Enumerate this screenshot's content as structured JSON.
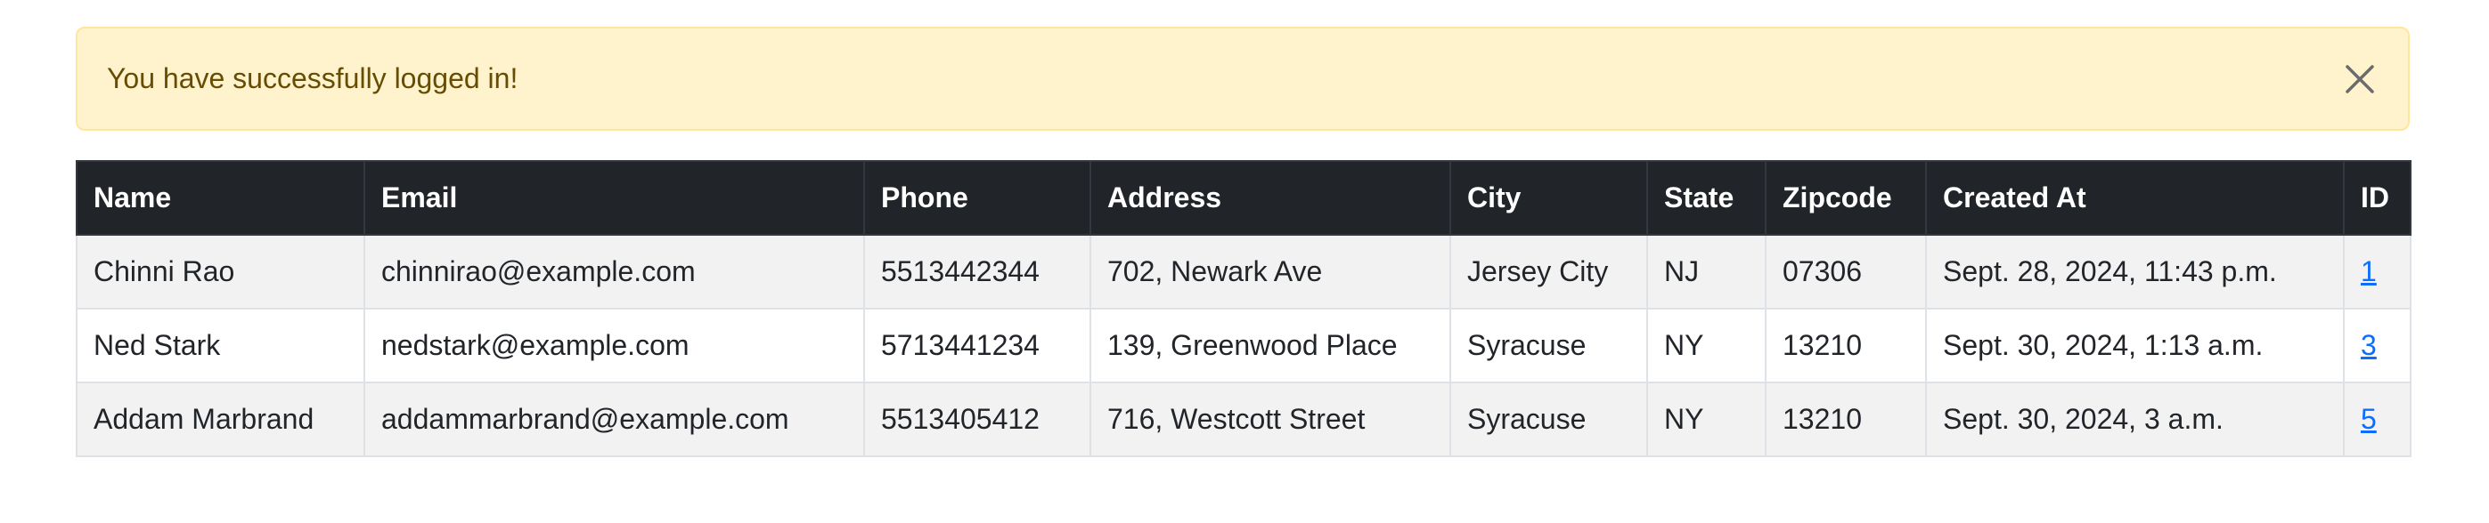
{
  "alert": {
    "message": "You have successfully logged in!",
    "close_icon": "close-icon"
  },
  "table": {
    "headers": [
      "Name",
      "Email",
      "Phone",
      "Address",
      "City",
      "State",
      "Zipcode",
      "Created At",
      "ID"
    ],
    "rows": [
      {
        "name": "Chinni Rao",
        "email": "chinnirao@example.com",
        "phone": "5513442344",
        "address": "702, Newark Ave",
        "city": "Jersey City",
        "state": "NJ",
        "zipcode": "07306",
        "created_at": "Sept. 28, 2024, 11:43 p.m.",
        "id": "1"
      },
      {
        "name": "Ned Stark",
        "email": "nedstark@example.com",
        "phone": "5713441234",
        "address": "139, Greenwood Place",
        "city": "Syracuse",
        "state": "NY",
        "zipcode": "13210",
        "created_at": "Sept. 30, 2024, 1:13 a.m.",
        "id": "3"
      },
      {
        "name": "Addam Marbrand",
        "email": "addammarbrand@example.com",
        "phone": "5513405412",
        "address": "716, Westcott Street",
        "city": "Syracuse",
        "state": "NY",
        "zipcode": "13210",
        "created_at": "Sept. 30, 2024, 3 a.m.",
        "id": "5"
      }
    ]
  },
  "colors": {
    "alert_bg": "#fff3cd",
    "alert_text": "#664d03",
    "header_bg": "#212529",
    "link": "#0d6efd"
  }
}
